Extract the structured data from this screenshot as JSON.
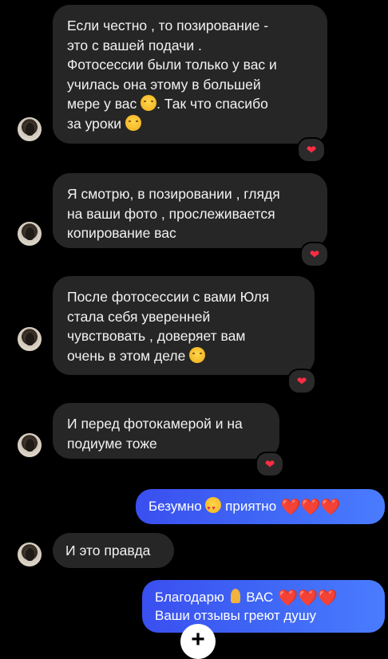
{
  "messages": [
    {
      "direction": "incoming",
      "lines": [
        "Если честно , то позирование -",
        "это с вашей подачи .",
        "Фотосессии были только у вас и",
        "училась она этому в большей",
        "мере у вас",
        ". Так что спасибо",
        "за уроки"
      ],
      "reaction": "❤"
    },
    {
      "direction": "incoming",
      "lines": [
        "Я смотрю, в позировании , глядя",
        "на ваши фото , прослеживается",
        "копирование вас"
      ],
      "reaction": "❤"
    },
    {
      "direction": "incoming",
      "lines": [
        "После фотосессии с вами Юля",
        "стала себя уверенней",
        "чувствовать , доверяет вам",
        "очень в этом деле"
      ],
      "reaction": "❤"
    },
    {
      "direction": "incoming",
      "lines": [
        "И перед фотокамерой и на",
        "подиуме тоже"
      ],
      "reaction": "❤"
    },
    {
      "direction": "outgoing",
      "text_a": "Безумно",
      "text_b": "приятно",
      "hearts": "❤️❤️❤️"
    },
    {
      "direction": "incoming",
      "lines": [
        "И это правда"
      ]
    },
    {
      "direction": "outgoing",
      "text_a": "Благодарю",
      "text_b": "ВАС",
      "hearts": "❤️❤️❤️",
      "line2": "Ваши отзывы греют душу"
    }
  ],
  "composer": {
    "add_symbol": "+"
  },
  "colors": {
    "incoming_bubble": "#262626",
    "outgoing_start": "#3a4ff0",
    "outgoing_end": "#4a7cff",
    "heart": "#ff2d44"
  },
  "icons": [
    "avatar",
    "smiling-face-with-hugging-hands-emoji",
    "smiling-face-with-heart-eyes-emoji",
    "folded-hands-emoji",
    "red-heart-emoji",
    "plus-icon"
  ]
}
